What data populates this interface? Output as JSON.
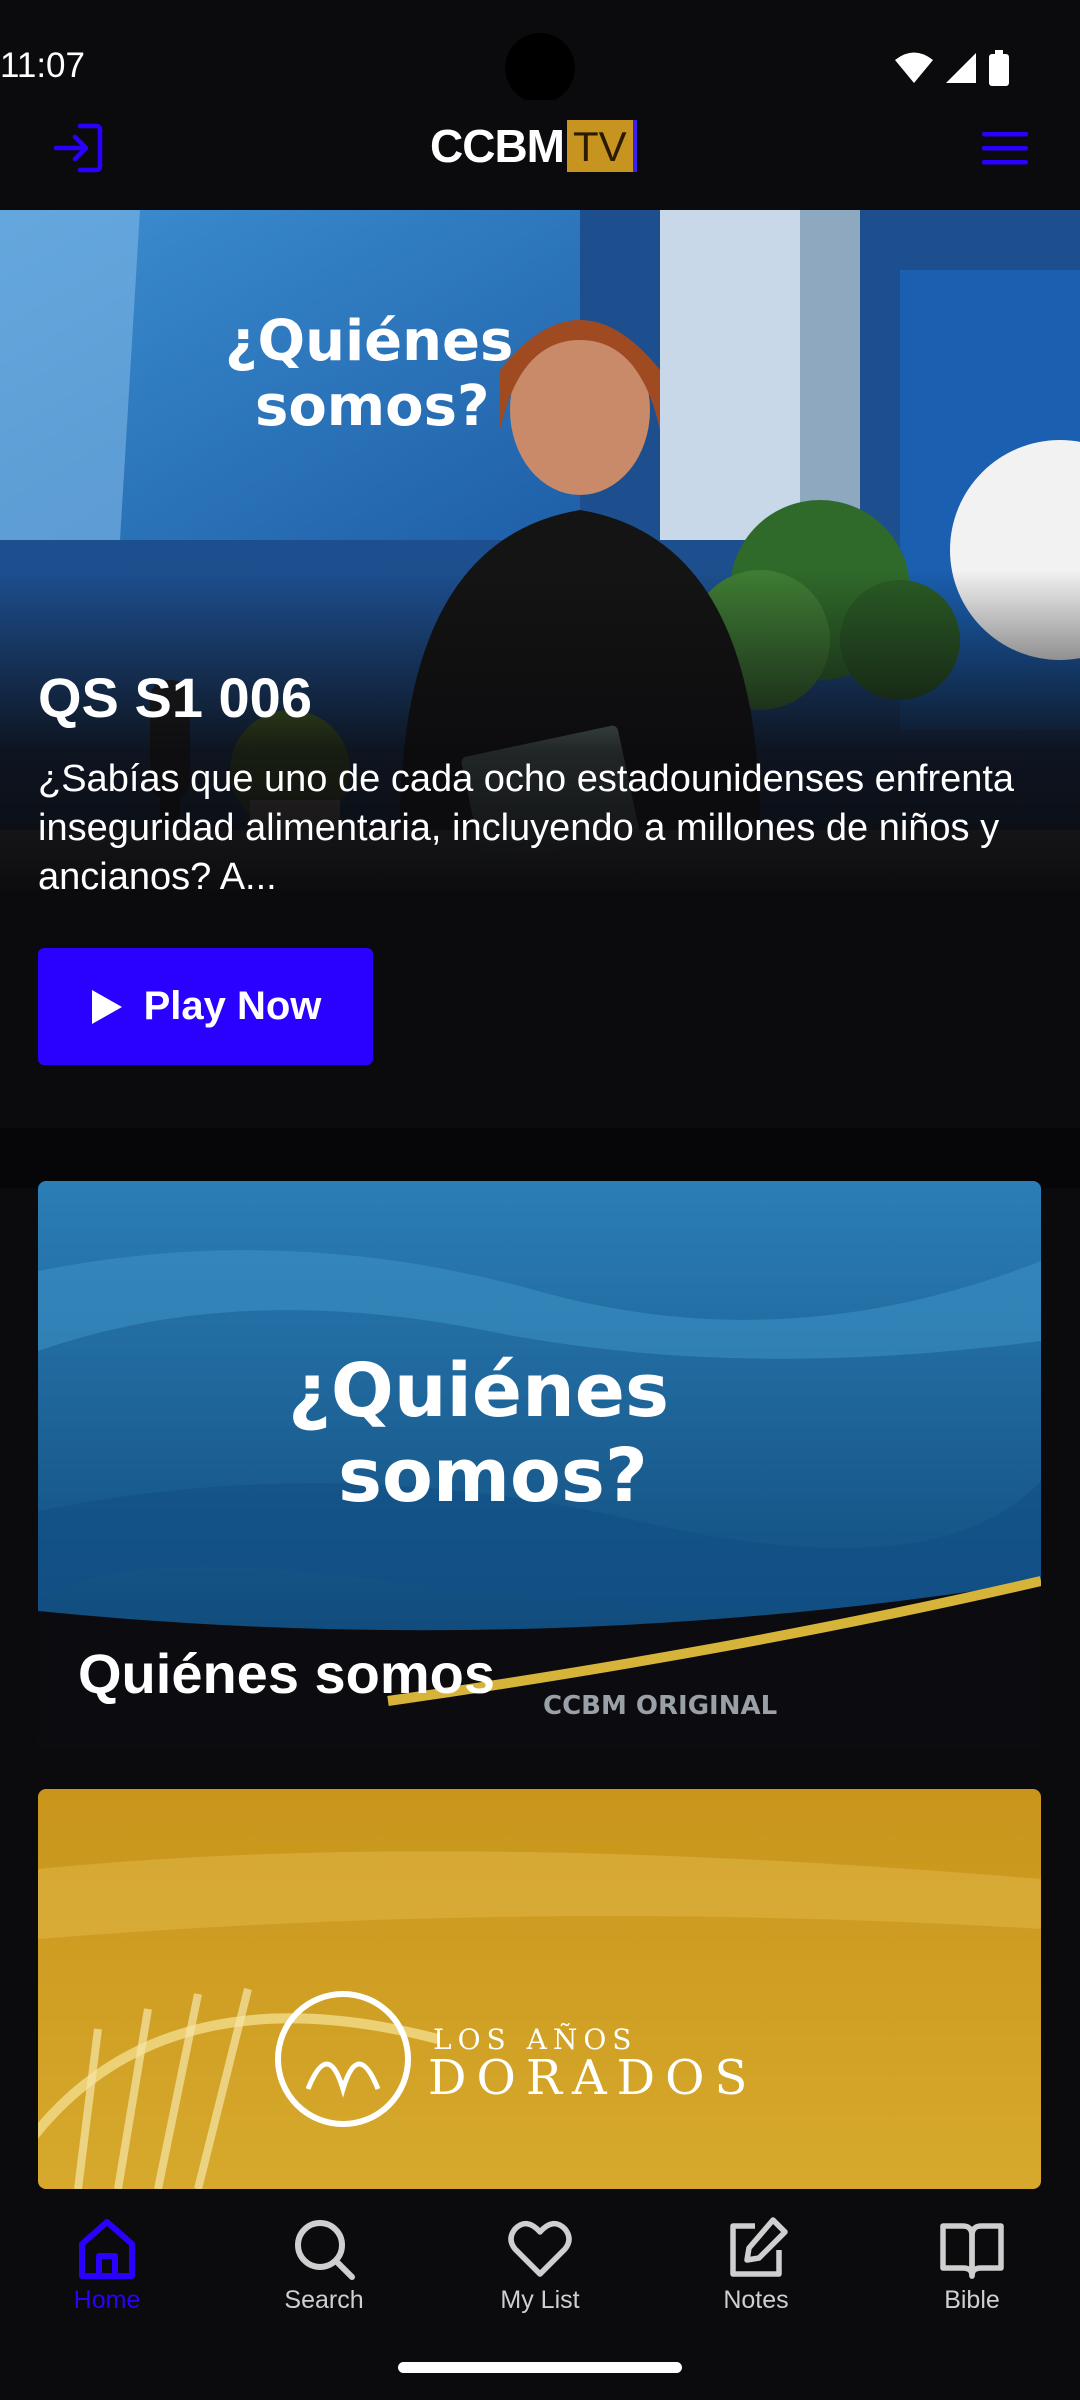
{
  "status_bar": {
    "time": "11:07"
  },
  "header": {
    "logo_text": "CCBM",
    "logo_badge": "TV",
    "login_icon": "login-icon",
    "menu_icon": "hamburger-menu-icon",
    "accent_color": "#2a00ff"
  },
  "hero": {
    "image_overlay_text_1": "¿Quiénes",
    "image_overlay_text_2": "somos?",
    "title": "QS S1 006",
    "description": "¿Sabías que uno de cada ocho estadounidenses enfrenta inseguridad alimentaria, incluyendo a millones de niños y ancianos? A...",
    "play_button_label": "Play Now"
  },
  "cards": [
    {
      "art_line_1": "¿Quiénes",
      "art_line_2": "somos?",
      "badge": "CCBM ORIGINAL",
      "title": "Quiénes somos"
    },
    {
      "art_line_1": "LOS AÑOS",
      "art_line_2": "DORADOS"
    }
  ],
  "bottom_nav": [
    {
      "label": "Home",
      "icon": "home-icon",
      "active": true
    },
    {
      "label": "Search",
      "icon": "search-icon",
      "active": false
    },
    {
      "label": "My List",
      "icon": "heart-icon",
      "active": false
    },
    {
      "label": "Notes",
      "icon": "edit-note-icon",
      "active": false
    },
    {
      "label": "Bible",
      "icon": "book-icon",
      "active": false
    }
  ]
}
